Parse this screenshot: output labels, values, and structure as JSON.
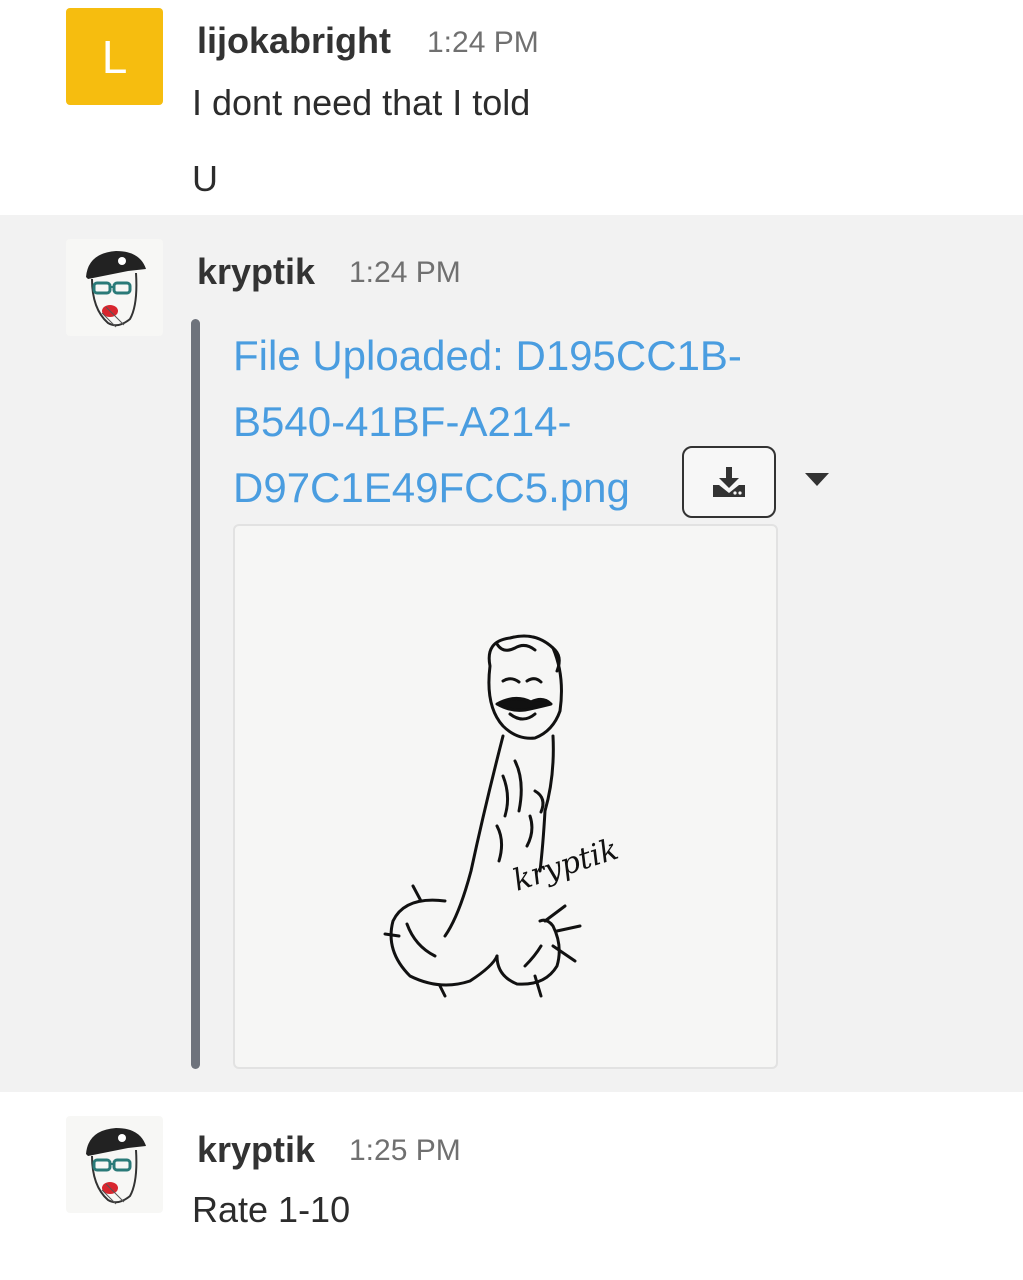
{
  "messages": [
    {
      "user": "lijokabright",
      "avatar_letter": "L",
      "avatar_color": "#f6bd0f",
      "time": "1:24 PM",
      "lines": [
        "I dont need that I told",
        "U"
      ]
    },
    {
      "user": "kryptik",
      "time": "1:24 PM",
      "attachment": {
        "title": "File Uploaded: D195CC1B-B540-41BF-A214-D97C1E49FCC5.png",
        "link_color": "#4a9de0",
        "download_icon": "download-icon",
        "menu_icon": "caret-down-icon",
        "preview_signature": "kryptik"
      }
    },
    {
      "user": "kryptik",
      "time": "1:25 PM",
      "lines": [
        "Rate 1-10"
      ]
    }
  ]
}
